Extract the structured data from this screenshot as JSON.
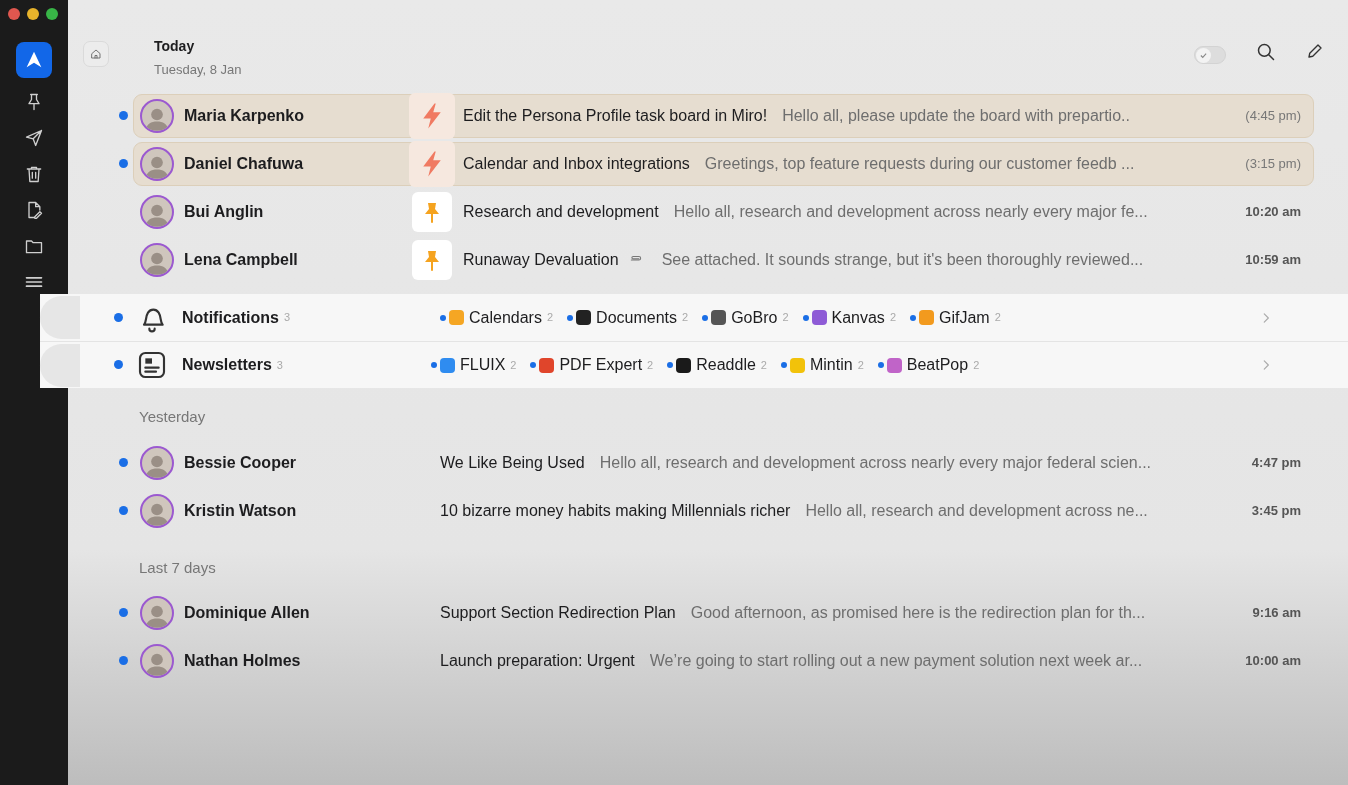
{
  "sidebar": {
    "items": [
      {
        "kind": "logo",
        "selected": true
      },
      {
        "kind": "pin",
        "selected": false
      },
      {
        "kind": "send",
        "selected": false
      },
      {
        "kind": "trash",
        "selected": false
      },
      {
        "kind": "draft",
        "selected": false
      },
      {
        "kind": "folder",
        "selected": false
      },
      {
        "kind": "menu",
        "selected": false
      }
    ]
  },
  "header": {
    "title": "Today",
    "subtitle": "Tuesday, 8 Jan",
    "toggle": {
      "on": false
    }
  },
  "today": [
    {
      "sender": "Maria Karpenko",
      "unread": true,
      "kind": "reminder",
      "subject": "Edit the Persona Profile task board in Miro!",
      "attachment": false,
      "preview": "Hello all, please update the board with prepartio..",
      "time": "(4:45 pm)"
    },
    {
      "sender": "Daniel Chafuwa",
      "unread": true,
      "kind": "reminder",
      "subject": "Calendar and Inbox integrations",
      "attachment": false,
      "preview": "Greetings, top feature requests during our customer feedb ...",
      "time": "(3:15 pm)"
    },
    {
      "sender": "Bui Anglin",
      "unread": false,
      "kind": "pinned",
      "subject": "Research and development",
      "attachment": false,
      "preview": "Hello all, research and development across nearly every major fe...",
      "time": "10:20 am"
    },
    {
      "sender": "Lena Campbell",
      "unread": false,
      "kind": "pinned",
      "subject": "Runaway Devaluation",
      "attachment": true,
      "preview": "See attached. It sounds strange, but it's been thoroughly reviewed...",
      "time": "10:59 am"
    }
  ],
  "groups": [
    {
      "kind": "bell",
      "name": "Notifications",
      "count": "3",
      "unread": true,
      "senders": [
        {
          "name": "Calendars",
          "count": "2",
          "unread": true,
          "color": "#f5a623"
        },
        {
          "name": "Documents",
          "count": "2",
          "unread": true,
          "color": "#222222"
        },
        {
          "name": "GoBro",
          "count": "2",
          "unread": true,
          "color": "#555555"
        },
        {
          "name": "Kanvas",
          "count": "2",
          "unread": true,
          "color": "#8e5bd6"
        },
        {
          "name": "GifJam",
          "count": "2",
          "unread": true,
          "color": "#f29a1e"
        }
      ]
    },
    {
      "kind": "newsletter",
      "name": "Newsletters",
      "count": "3",
      "unread": true,
      "senders": [
        {
          "name": "FLUIX",
          "count": "2",
          "unread": true,
          "color": "#2f8cf0"
        },
        {
          "name": "PDF Expert",
          "count": "2",
          "unread": true,
          "color": "#e0452b"
        },
        {
          "name": "Readdle",
          "count": "2",
          "unread": true,
          "color": "#1a1a1a"
        },
        {
          "name": "Mintin",
          "count": "2",
          "unread": true,
          "color": "#f2c20a"
        },
        {
          "name": "BeatPop",
          "count": "2",
          "unread": true,
          "color": "#c064c8"
        }
      ]
    }
  ],
  "sections": [
    {
      "heading": "Yesterday",
      "messages": [
        {
          "sender": "Bessie Cooper",
          "unread": true,
          "subject": "We Like Being Used",
          "attachment": false,
          "preview": "Hello all, research and development across nearly every major federal scien...",
          "time": "4:47 pm"
        },
        {
          "sender": "Kristin Watson",
          "unread": true,
          "subject": "10 bizarre money habits making Millennials richer",
          "attachment": false,
          "preview": "Hello all, research and development across ne...",
          "time": "3:45 pm"
        }
      ]
    },
    {
      "heading": "Last 7 days",
      "messages": [
        {
          "sender": "Dominique Allen",
          "unread": true,
          "subject": "Support Section Redirection Plan",
          "attachment": false,
          "preview": "Good afternoon, as promised here is the redirection plan for th...",
          "time": "9:16 am"
        },
        {
          "sender": "Nathan Holmes",
          "unread": true,
          "subject": "Launch preparation: Urgent",
          "attachment": false,
          "preview": "We’re going to start rolling out a new payment solution next week ar...",
          "time": "10:00 am"
        }
      ]
    }
  ]
}
